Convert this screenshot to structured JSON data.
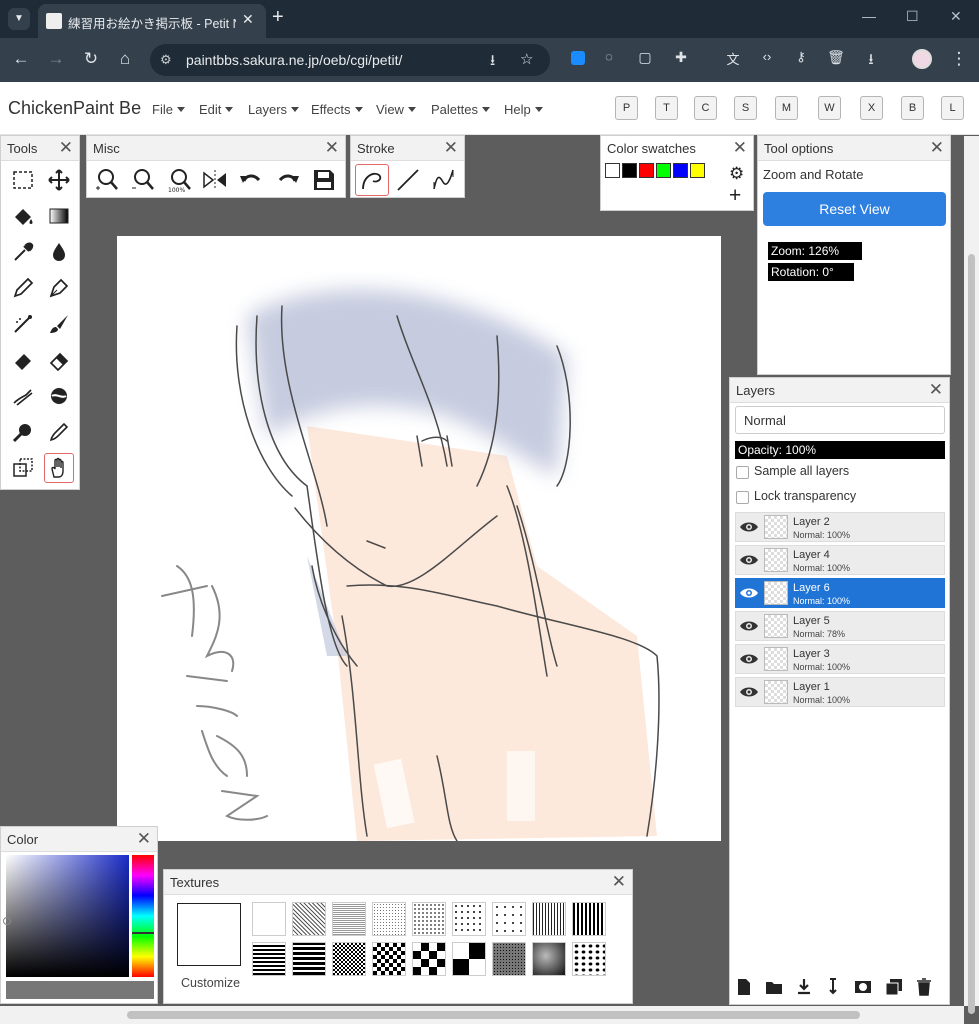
{
  "browser": {
    "tab_title": "練習用お絵かき掲示板 - Petit Note",
    "tab_close": "✕",
    "new_tab": "+",
    "url": "paintbbs.sakura.ne.jp/oeb/cgi/petit/",
    "window_buttons": [
      "—",
      "☐",
      "✕"
    ]
  },
  "app": {
    "name": "ChickenPaint Be",
    "menus": [
      "File",
      "Edit",
      "Layers",
      "Effects",
      "View",
      "Palettes",
      "Help"
    ],
    "palette_toggles": [
      "P",
      "T",
      "C",
      "S",
      "M",
      "W",
      "X",
      "B",
      "L"
    ]
  },
  "panels": {
    "tools": {
      "title": "Tools"
    },
    "misc": {
      "title": "Misc"
    },
    "stroke": {
      "title": "Stroke"
    },
    "swatches": {
      "title": "Color swatches",
      "colors": [
        "#ffffff",
        "#000000",
        "#ff0000",
        "#00ff00",
        "#0000ff",
        "#ffff00"
      ]
    },
    "tool_options": {
      "title": "Tool options",
      "tool_name": "Zoom and Rotate",
      "reset_label": "Reset View",
      "zoom": "Zoom: 126%",
      "rotation": "Rotation: 0°"
    },
    "layers": {
      "title": "Layers",
      "blend_mode": "Normal",
      "opacity": "Opacity: 100%",
      "sample_all": "Sample all layers",
      "lock_transparency": "Lock transparency",
      "items": [
        {
          "name": "Layer 2",
          "blend": "Normal: 100%"
        },
        {
          "name": "Layer 4",
          "blend": "Normal: 100%"
        },
        {
          "name": "Layer 6",
          "blend": "Normal: 100%",
          "selected": true
        },
        {
          "name": "Layer 5",
          "blend": "Normal: 78%"
        },
        {
          "name": "Layer 3",
          "blend": "Normal: 100%"
        },
        {
          "name": "Layer 1",
          "blend": "Normal: 100%"
        }
      ]
    },
    "color": {
      "title": "Color"
    },
    "textures": {
      "title": "Textures",
      "customize": "Customize"
    }
  },
  "close_glyph": "✕",
  "accent_color": "#1f74d6"
}
